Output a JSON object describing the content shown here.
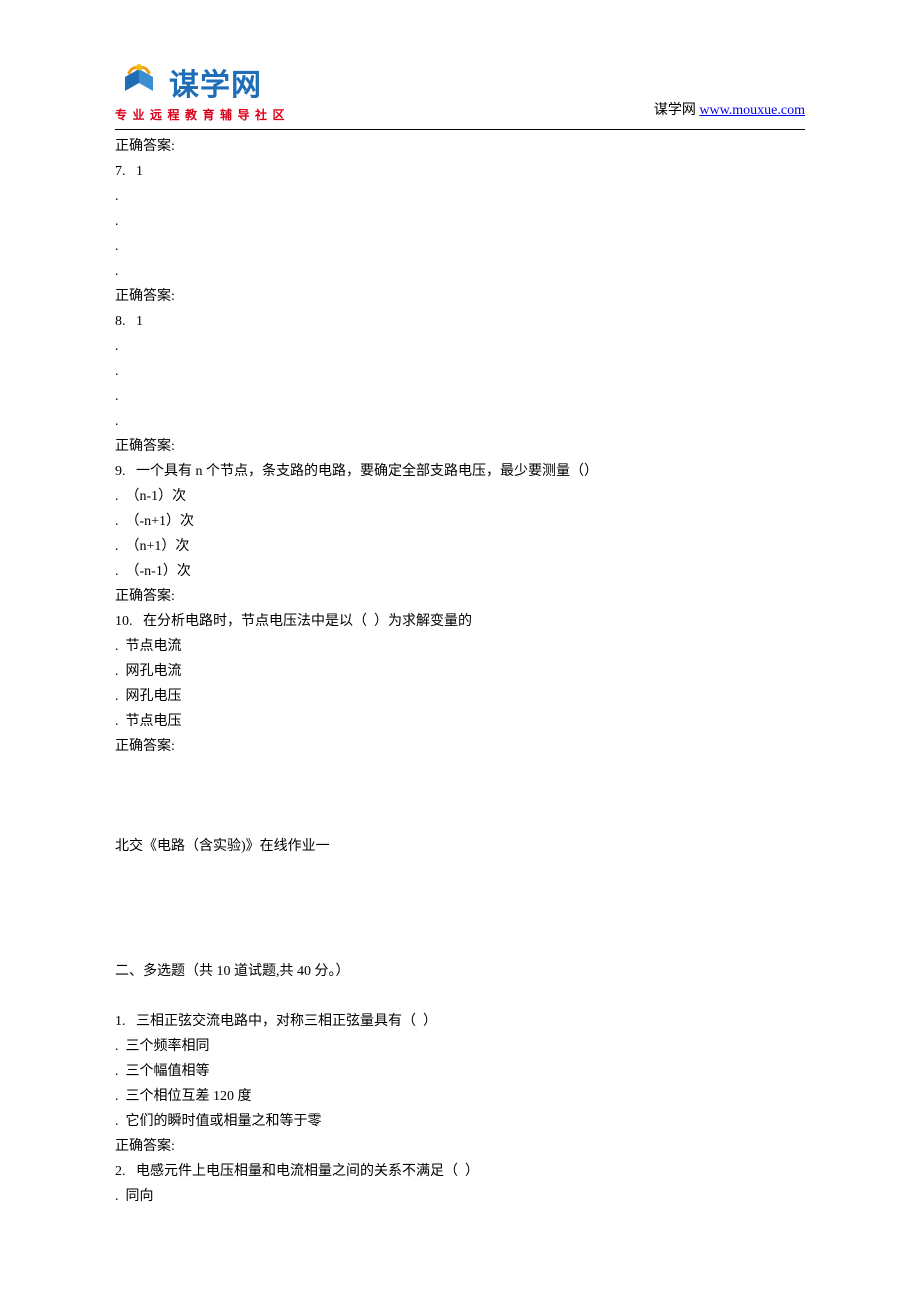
{
  "header": {
    "logo_name": "谋学网",
    "logo_sub": "专业远程教育辅导社区",
    "site_prefix": "谋学网 ",
    "site_url": "www.mouxue.com"
  },
  "lines": [
    "正确答案:",
    "7.   1",
    ".  ",
    ".  ",
    ".  ",
    ".  ",
    "正确答案:",
    "8.   1",
    ".  ",
    ".  ",
    ".  ",
    ".  ",
    "正确答案:",
    "9.   一个具有 n 个节点，条支路的电路，要确定全部支路电压，最少要测量（）",
    ".  （n-1）次",
    ".  （-n+1）次",
    ".  （n+1）次",
    ".  （-n-1）次",
    "正确答案:",
    "10.   在分析电路时，节点电压法中是以（  ）为求解变量的",
    ".  节点电流",
    ".  网孔电流",
    ".  网孔电压",
    ".  节点电压",
    "正确答案:",
    "",
    "",
    "",
    "北交《电路（含实验)》在线作业一",
    "",
    "",
    "",
    "",
    "二、多选题（共 10 道试题,共 40 分。）",
    "",
    "1.   三相正弦交流电路中，对称三相正弦量具有（  ）",
    ".  三个频率相同",
    ".  三个幅值相等",
    ".  三个相位互差 120 度",
    ".  它们的瞬时值或相量之和等于零",
    "正确答案:",
    "2.   电感元件上电压相量和电流相量之间的关系不满足（  ）",
    ".  同向"
  ]
}
